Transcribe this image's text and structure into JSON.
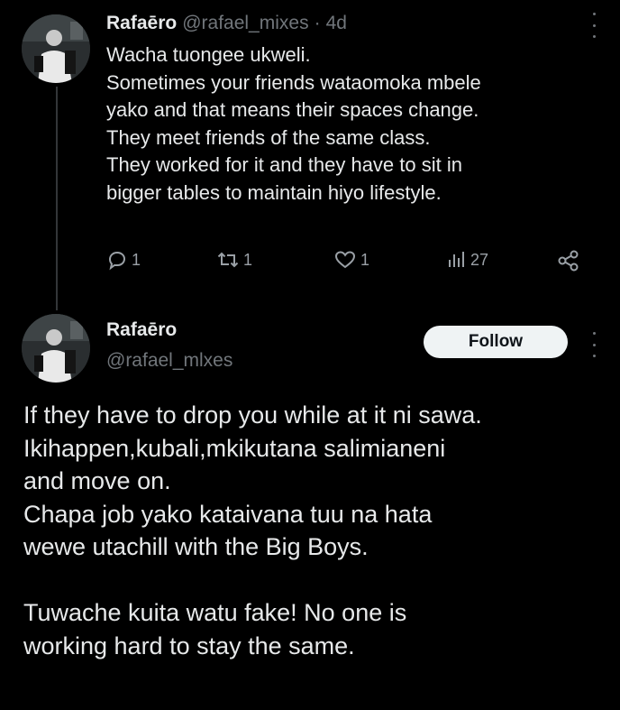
{
  "reply": {
    "display_name": "Rafaēro",
    "handle": "@rafael_mixes",
    "separator": "·",
    "time": "4d",
    "lines": [
      "Wacha tuongee ukweli.",
      "Sometimes your friends wataomoka mbele",
      "yako and that means their spaces change.",
      "They meet friends of the same class.",
      "They worked for it and they have to sit in",
      "bigger tables to maintain hiyo lifestyle."
    ],
    "actions": {
      "replies": "1",
      "reposts": "1",
      "likes": "1",
      "views": "27"
    }
  },
  "main": {
    "display_name": "Rafaēro",
    "handle": "@rafael_mlxes",
    "follow_label": "Follow",
    "lines": [
      "If they have to drop you while at it ni sawa.",
      "Ikihappen,kubali,mkikutana salimianeni",
      "and move on.",
      "Chapa job yako kataivana tuu na hata",
      "wewe utachill with the Big Boys.",
      "",
      "Tuwache kuita watu fake! No one is",
      "working hard to stay the same."
    ]
  },
  "icons": {
    "reply": "reply-icon",
    "repost": "repost-icon",
    "like": "heart-icon",
    "views": "views-icon",
    "share": "share-icon",
    "more": "more-icon"
  },
  "colors": {
    "background": "#000000",
    "text": "#e7e9ea",
    "muted": "#71767b",
    "follow_bg": "#eff3f4"
  }
}
